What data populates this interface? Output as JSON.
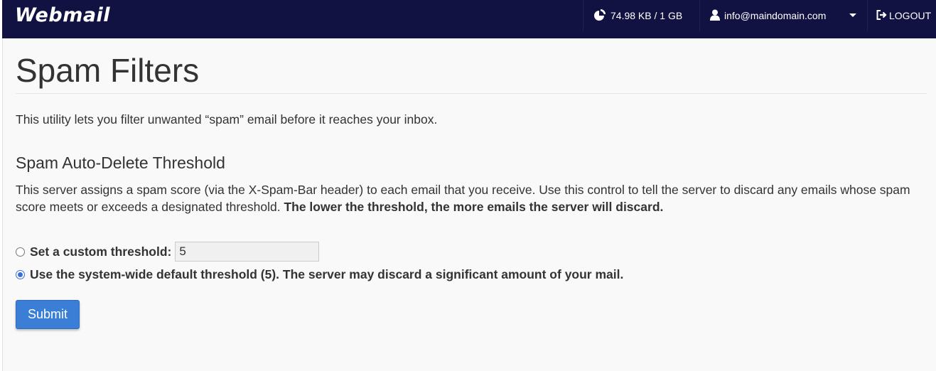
{
  "header": {
    "brand": "Webmail",
    "quota": "74.98 KB / 1 GB",
    "account": "info@maindomain.com",
    "logout": "LOGOUT",
    "background": "#121242"
  },
  "page": {
    "title": "Spam Filters",
    "intro": "This utility lets you filter unwanted “spam” email before it reaches your inbox.",
    "section_title": "Spam Auto-Delete Threshold",
    "description": "This server assigns a spam score (via the X-Spam-Bar header) to each email that you receive. Use this control to tell the server to discard any emails whose spam score meets or exceeds a designated threshold.",
    "description_bold": "The lower the threshold, the more emails the server will discard."
  },
  "form": {
    "custom_label": "Set a custom threshold:",
    "custom_value": "5",
    "custom_selected": false,
    "default_label": "Use the system-wide default threshold (5). The server may discard a significant amount of your mail.",
    "default_selected": true,
    "submit_label": "Submit",
    "accent": "#3a7fd5"
  },
  "icons": {
    "quota": "pie-chart-icon",
    "account": "user-icon",
    "account_menu": "caret-down-icon",
    "logout": "sign-out-icon"
  }
}
